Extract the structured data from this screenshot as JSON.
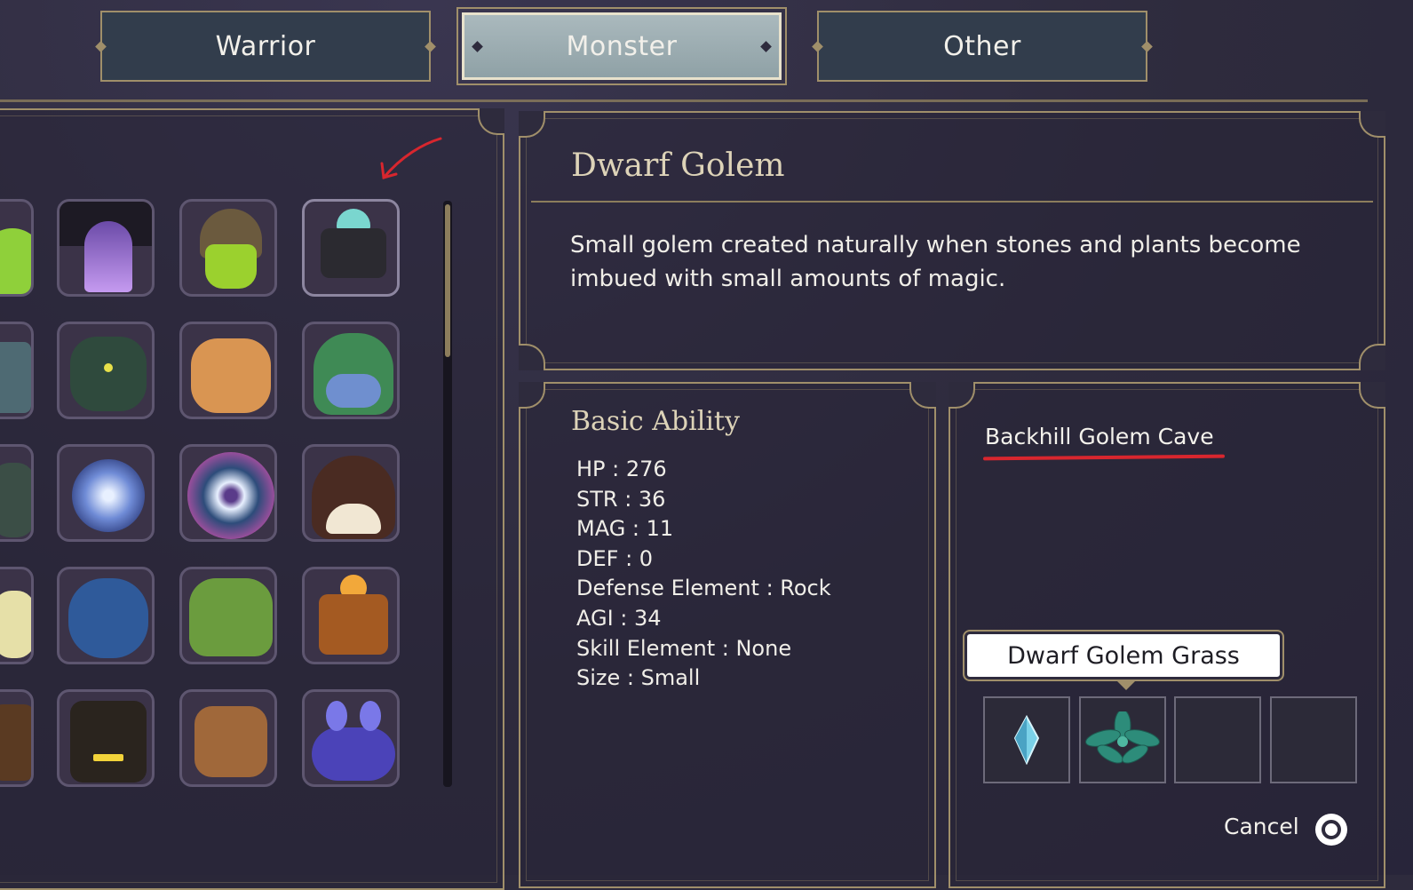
{
  "tabs": [
    {
      "label": "Warrior",
      "active": false
    },
    {
      "label": "Monster",
      "active": true
    },
    {
      "label": "Other",
      "active": false
    }
  ],
  "monster": {
    "name": "Dwarf Golem",
    "description": "Small golem created naturally when stones and plants become imbued with small amounts of magic."
  },
  "basic_ability": {
    "heading": "Basic Ability",
    "stats": [
      "HP : 276",
      "STR : 36",
      "MAG : 11",
      "DEF : 0",
      "Defense Element : Rock",
      "AGI : 34",
      "Skill Element : None",
      "Size : Small"
    ]
  },
  "location": {
    "name": "Backhill Golem Cave"
  },
  "drops": {
    "label": "Dwarf Golem Grass",
    "slots": [
      "crystal-item",
      "leaf-item",
      "",
      ""
    ]
  },
  "footer": {
    "cancel_label": "Cancel",
    "cancel_button_icon": "circle-button-icon"
  },
  "colors": {
    "accent_gold": "#a08f6a",
    "annotation_red": "#d8262e",
    "tab_active": "#9fb1b5",
    "tab_inactive": "#323d4c"
  },
  "grid": {
    "rows": [
      [
        "green-slime",
        "purple-ghost",
        "helmet-slime",
        "stone-plant-golem"
      ],
      [
        "stone-golem-partial",
        "mossy-stone-beast",
        "pig-beast",
        "frog-monster"
      ],
      [
        "hooded-monster-partial",
        "blue-flower",
        "pink-flower",
        "brown-bird"
      ],
      [
        "leaf-fairy-partial",
        "blue-rock-creature",
        "grass-creature",
        "fire-block-golem"
      ],
      [
        "totem-partial",
        "dark-totem",
        "bronze-cannon",
        "purple-crab"
      ]
    ],
    "selected": "stone-plant-golem"
  }
}
